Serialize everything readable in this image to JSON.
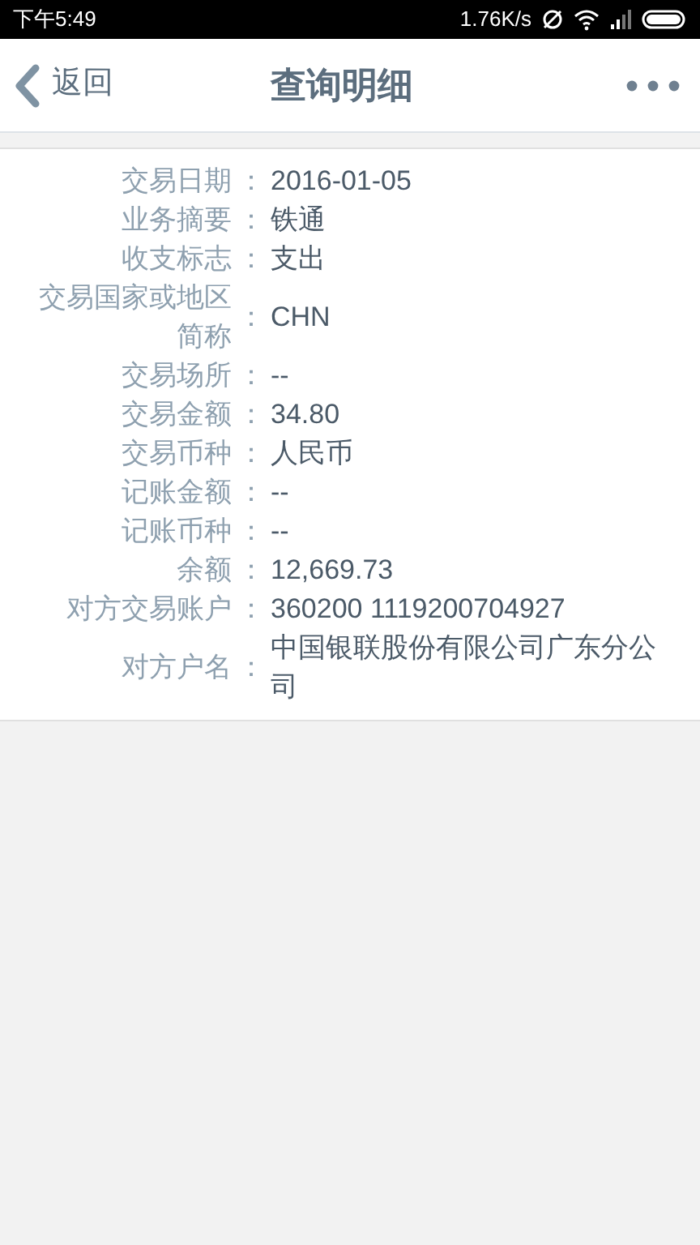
{
  "status_bar": {
    "time": "下午5:49",
    "speed": "1.76K/s"
  },
  "header": {
    "back": "返回",
    "title": "查询明细"
  },
  "details": [
    {
      "label": "交易日期",
      "separator": "：",
      "value": "2016-01-05"
    },
    {
      "label": "业务摘要",
      "separator": "：",
      "value": "铁通"
    },
    {
      "label": "收支标志",
      "separator": "：",
      "value": "支出"
    },
    {
      "label": "交易国家或地区简称",
      "separator": "：",
      "value": "CHN"
    },
    {
      "label": "交易场所",
      "separator": "：",
      "value": "--"
    },
    {
      "label": "交易金额",
      "separator": "：",
      "value": "34.80"
    },
    {
      "label": "交易币种",
      "separator": "：",
      "value": "人民币"
    },
    {
      "label": "记账金额",
      "separator": "：",
      "value": "--"
    },
    {
      "label": "记账币种",
      "separator": "：",
      "value": "--"
    },
    {
      "label": "余额",
      "separator": "：",
      "value": "12,669.73"
    },
    {
      "label": "对方交易账户",
      "separator": "：",
      "value": "360200 1119200704927"
    },
    {
      "label": "对方户名",
      "separator": "：",
      "value": "中国银联股份有限公司广东分公司"
    }
  ]
}
